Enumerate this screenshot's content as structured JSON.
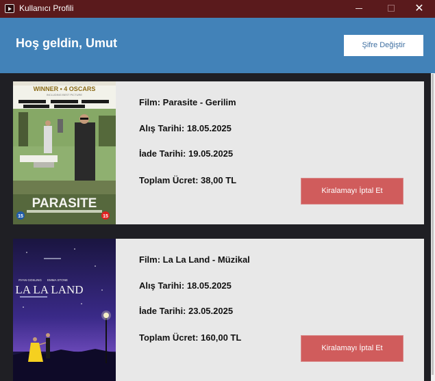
{
  "window": {
    "title": "Kullanıcı Profili",
    "controls": {
      "minimize": "—",
      "maximize": "☐",
      "close": "✕"
    }
  },
  "header": {
    "greeting": "Hoş geldin, Umut",
    "change_password_label": "Şifre Değiştir"
  },
  "rentals": [
    {
      "film": "Film: Parasite - Gerilim",
      "purchase_date": "Alış Tarihi: 18.05.2025",
      "return_date": "İade Tarihi: 19.05.2025",
      "total": "Toplam Ücret: 38,00 TL",
      "cancel_label": "Kiralamayı İptal Et",
      "poster": {
        "award": "WINNER • 4 OSCARS",
        "award_sub": "INCLUDING BEST PICTURE",
        "title": "PARASITE",
        "rating": "15"
      }
    },
    {
      "film": "Film: La La Land - Müzikal",
      "purchase_date": "Alış Tarihi: 18.05.2025",
      "return_date": "İade Tarihi: 23.05.2025",
      "total": "Toplam Ücret: 160,00 TL",
      "cancel_label": "Kiralamayı İptal Et",
      "poster": {
        "cast_left": "RYAN GOSLING",
        "cast_right": "EMMA STONE",
        "title": "LA LA LAND"
      }
    }
  ],
  "colors": {
    "titlebar": "#5a1a1c",
    "header": "#4282b8",
    "cancel_button": "#d05c5c",
    "card": "#e8e8e8",
    "background": "#1f1f24"
  }
}
